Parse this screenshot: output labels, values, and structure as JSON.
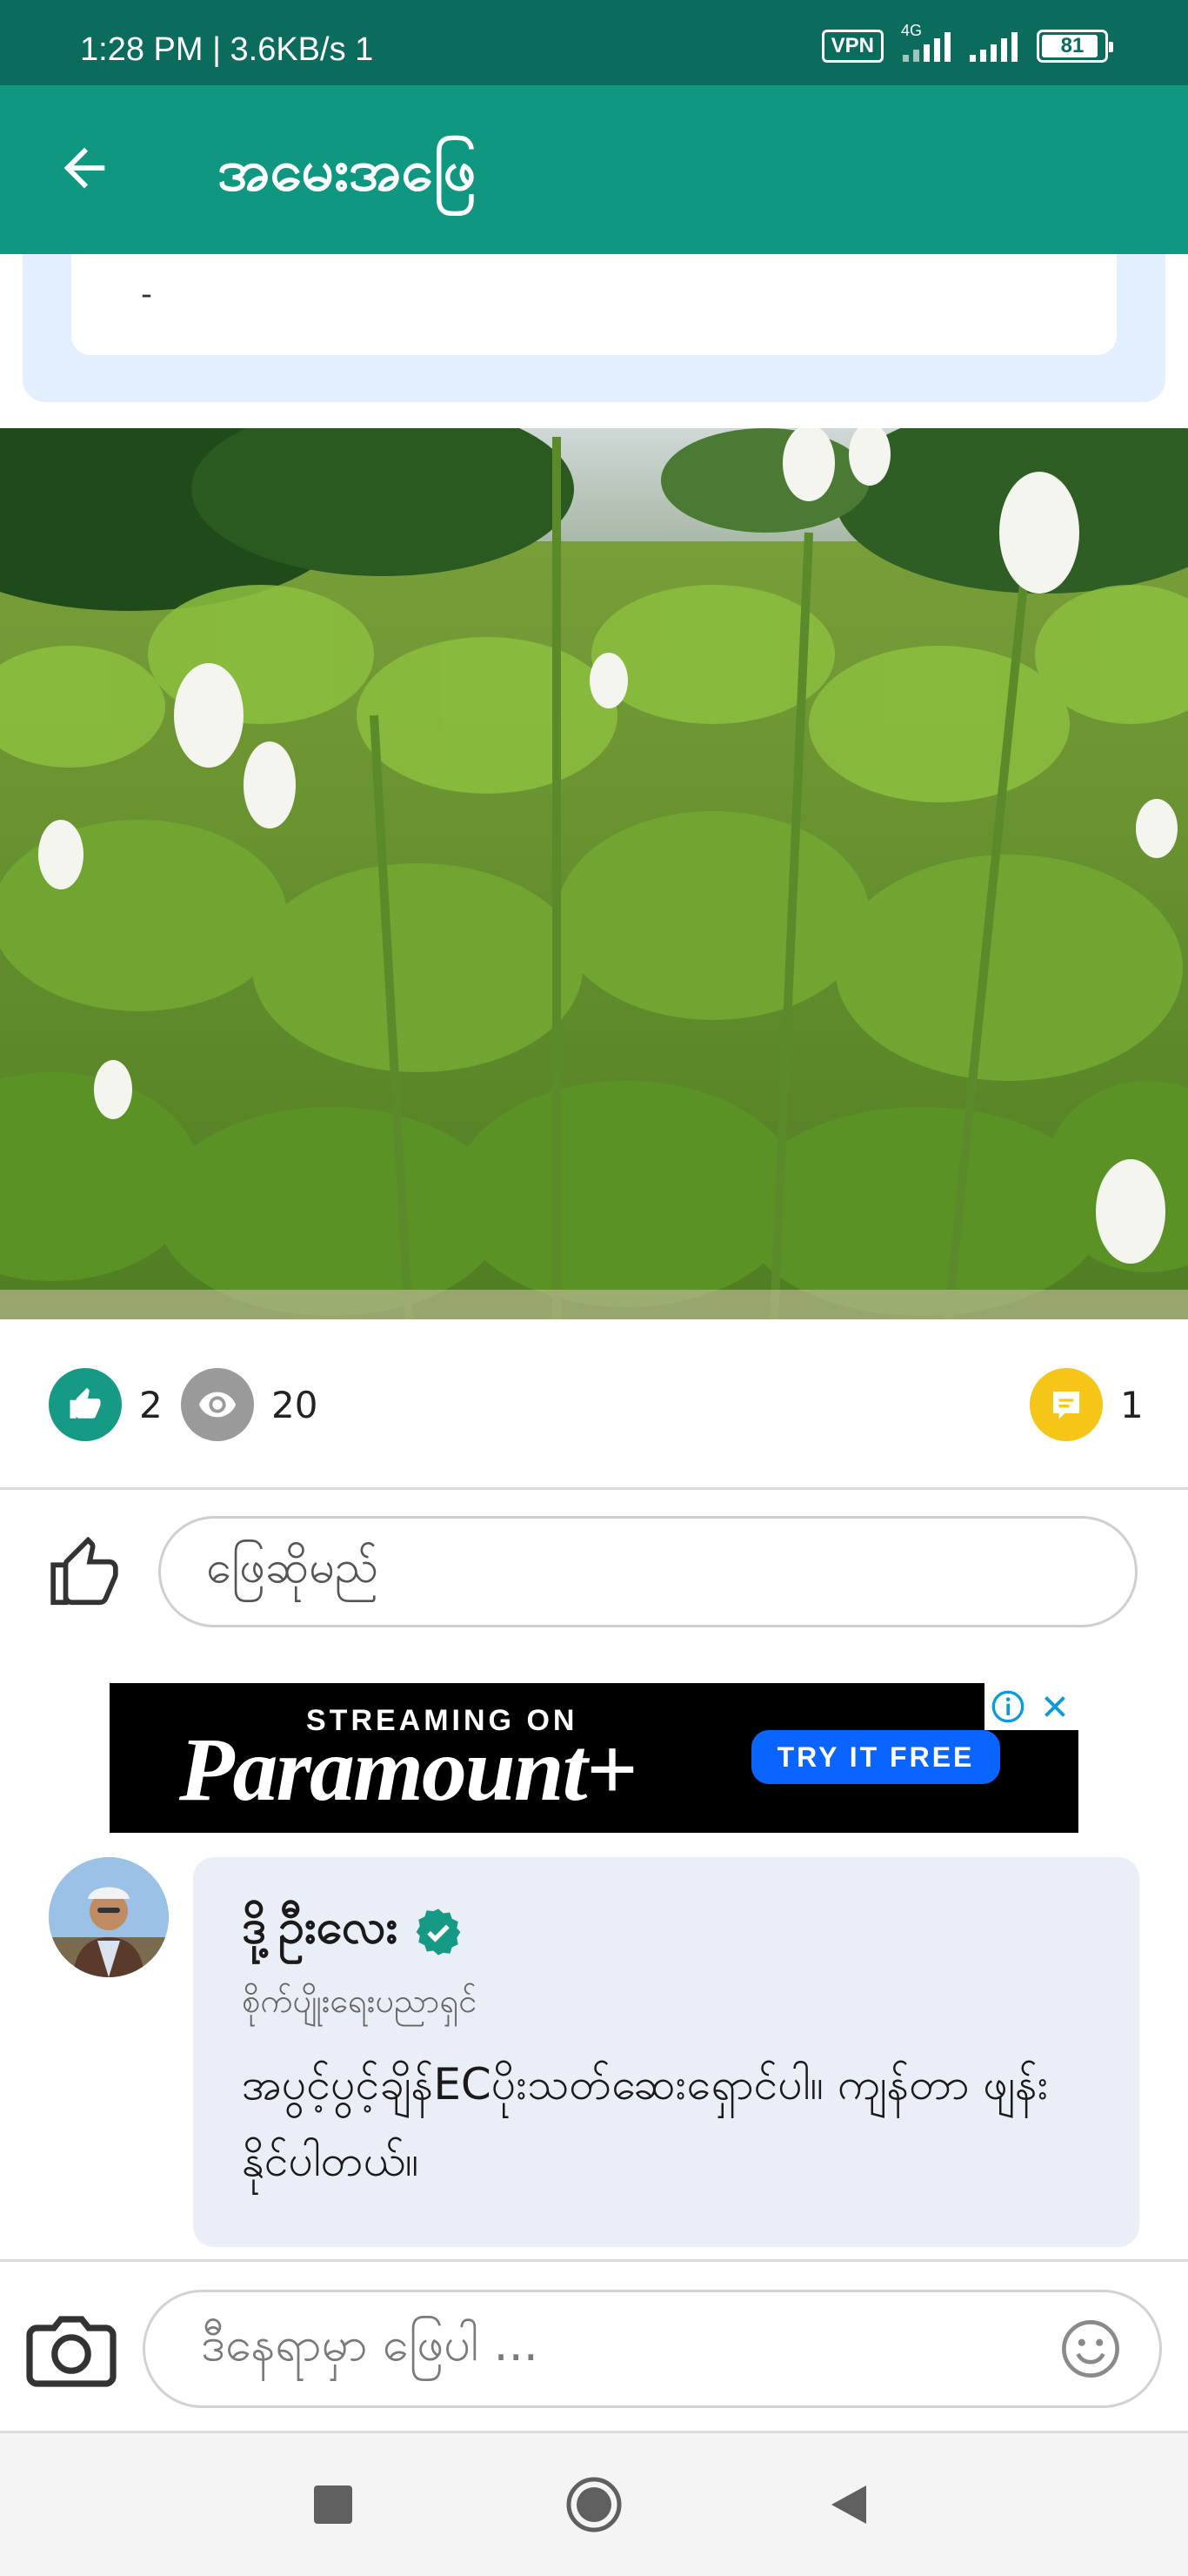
{
  "status_bar": {
    "time": "1:28 PM | 3.6KB/s 1",
    "vpn_label": "VPN",
    "network": "4G",
    "battery": "81"
  },
  "app_bar": {
    "title": "အမေးအဖြေ",
    "back_icon": "arrow-left-icon"
  },
  "question": {
    "detail_text": "-"
  },
  "photo": {
    "subject": "sesame field"
  },
  "stats": {
    "likes": "2",
    "views": "20",
    "comments": "1",
    "like_color": "#179a85",
    "view_color": "#9a9a9a",
    "comment_color": "#f5c518"
  },
  "reply_action": {
    "placeholder": "ဖြေဆိုမည်"
  },
  "ad": {
    "streaming_label": "STREAMING ON",
    "brand": "Paramount+",
    "cta_label": "TRY IT FREE"
  },
  "answer": {
    "author_name": "ဒို့ဦးလေး",
    "author_role": "စိုက်ပျိုးရေးပညာရှင်",
    "body": "အပွင့်ပွင့်ချိန်ECပိုးသတ်ဆေးရှောင်ပါ။ ကျန်တာ ဖျန်းနိုင်ပါတယ်။",
    "verified_color": "#179a85"
  },
  "composer": {
    "placeholder": "ဒီနေရာမှာ ဖြေပါ ..."
  },
  "colors": {
    "status_bar": "#0b6b5d",
    "app_bar": "#0f9781",
    "bubble": "#eaeef7"
  }
}
